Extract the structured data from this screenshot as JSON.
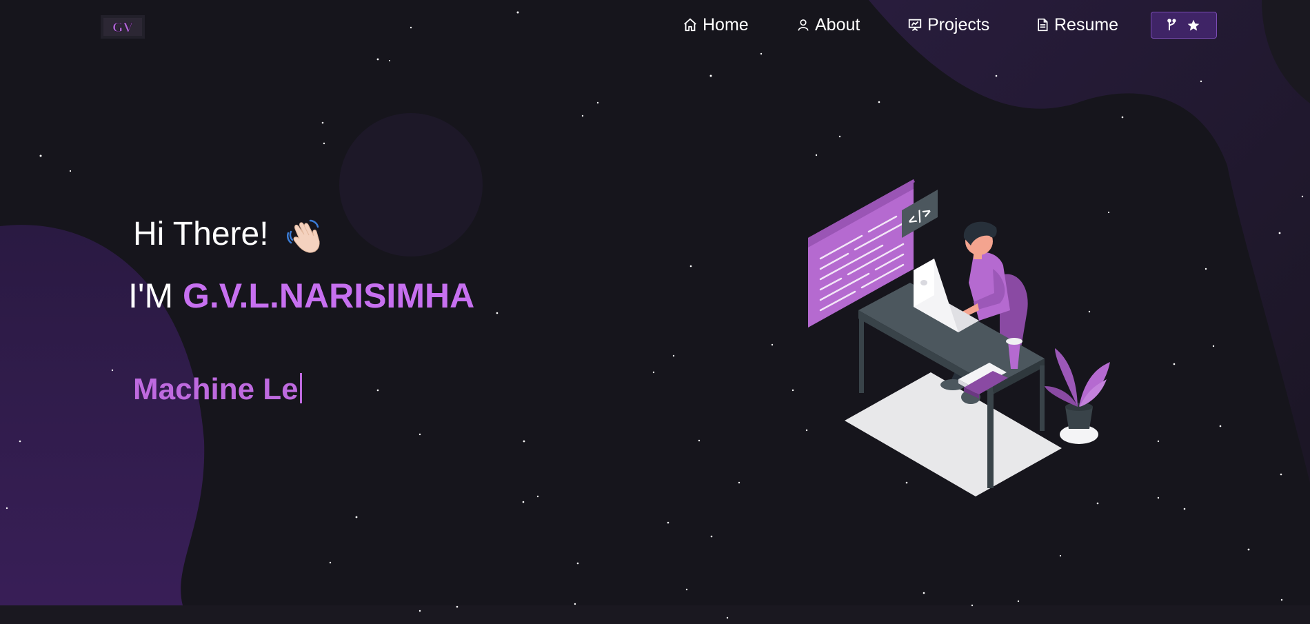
{
  "logo": {
    "alt": "GV"
  },
  "nav": {
    "home": "Home",
    "about": "About",
    "projects": "Projects",
    "resume": "Resume"
  },
  "github_button": {
    "icons": [
      "fork-icon",
      "star-icon"
    ]
  },
  "hero": {
    "greeting": "Hi There!",
    "name_prefix": "I'M",
    "name": "G.V.L.NARISIMHA",
    "typed_text": "Machine Le"
  },
  "colors": {
    "background": "#16151c",
    "accent": "#c770f0",
    "button_bg": "#3f2466"
  }
}
